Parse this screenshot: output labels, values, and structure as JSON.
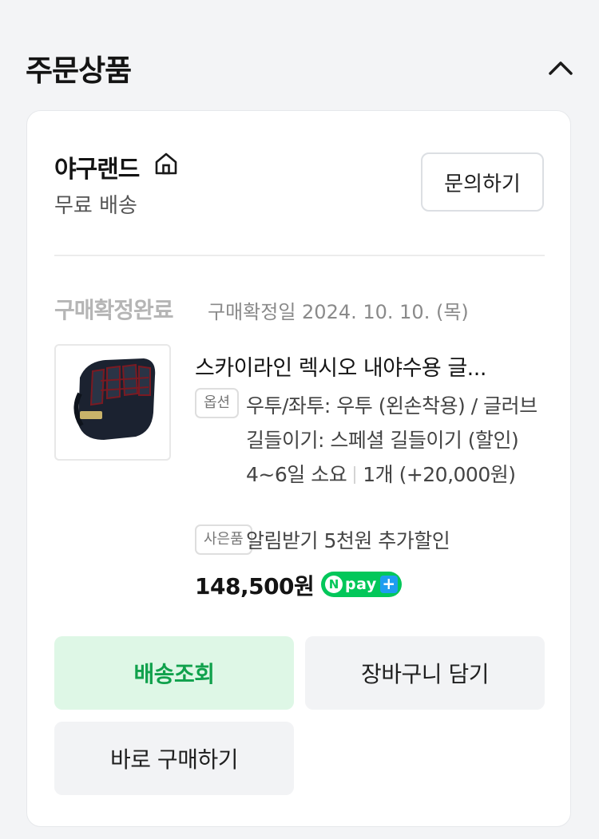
{
  "section": {
    "title": "주문상품"
  },
  "store": {
    "name": "야구랜드",
    "shipping": "무료 배송",
    "inquiry_label": "문의하기"
  },
  "order": {
    "status": "구매확정완료",
    "confirm_date": "구매확정일 2024. 10. 10. (목)"
  },
  "product": {
    "name": "스카이라인 렉시오 내야수용 글...",
    "option_tag": "옵션",
    "option_text": "우투/좌투: 우투 (왼손착용) / 글러브 길들이기: 스페셜 길들이기 (할인) 4~6일 소요",
    "quantity_text": "1개 (+20,000원)",
    "gift_tag": "사은품",
    "gift_text": "알림받기 5천원 추가할인",
    "price": "148,500원",
    "npay_label": "pay"
  },
  "actions": {
    "track_label": "배송조회",
    "cart_label": "장바구니 담기",
    "buy_label": "바로 구매하기"
  },
  "colors": {
    "accent_green": "#03c75a",
    "track_text": "#10a14c",
    "track_bg": "#def7e6"
  }
}
